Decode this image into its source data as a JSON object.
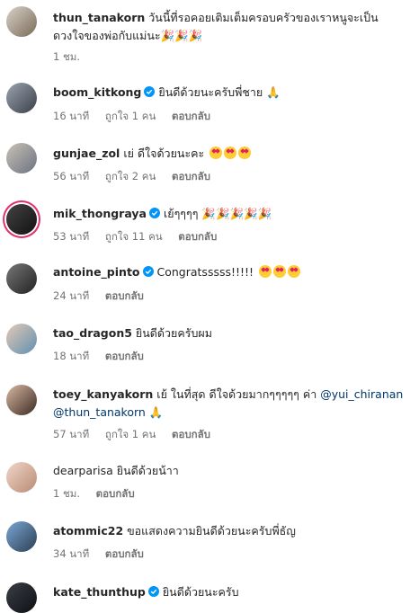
{
  "comments": [
    {
      "username": "thun_tanakorn",
      "text": "วันนี้ที่รอคอยเติมเต็มครอบครัวของเราหนูจะเป็นดวงใจของพ่อกับแม่นะ🎉🎉🎉",
      "time": "1 ชม.",
      "verified": false
    },
    {
      "username": "boom_kitkong",
      "text": "ยินดีด้วยนะครับพี่ชาย 🙏",
      "time": "16 นาที",
      "likes": "ถูกใจ 1 คน",
      "reply": "ตอบกลับ",
      "verified": true
    },
    {
      "username": "gunjae_zol",
      "text": "เย่ ดีใจด้วยนะคะ",
      "time": "56 นาที",
      "likes": "ถูกใจ 2 คน",
      "reply": "ตอบกลับ",
      "verified": false
    },
    {
      "username": "mik_thongraya",
      "text": "เย้ๆๆๆๆ 🎉🎉🎉🎉🎉",
      "time": "53 นาที",
      "likes": "ถูกใจ 11 คน",
      "reply": "ตอบกลับ",
      "verified": true
    },
    {
      "username": "antoine_pinto",
      "text": "Congratsssss!!!!!",
      "time": "24 นาที",
      "reply": "ตอบกลับ",
      "verified": true
    },
    {
      "username": "tao_dragon5",
      "text": "ยินดีด้วยครับผม",
      "time": "18 นาที",
      "reply": "ตอบกลับ",
      "verified": false
    },
    {
      "username": "toey_kanyakorn",
      "text": "เย้ ในที่สุด ดีใจด้วยมากๆๆๆๆๆ ค่า",
      "mention1": "@yui_chiranan",
      "mention2": "@thun_tanakorn",
      "text_end": "🙏",
      "time": "57 นาที",
      "likes": "ถูกใจ 1 คน",
      "reply": "ตอบกลับ",
      "verified": false
    },
    {
      "username": "dearparisa",
      "text": "ยินดีด้วยน้าา",
      "time": "1 ชม.",
      "reply": "ตอบกลับ",
      "verified": false
    },
    {
      "username": "atommic22",
      "text": "ขอแสดงความยินดีด้วยนะครับพี่ธัญ",
      "time": "34 นาที",
      "reply": "ตอบกลับ",
      "verified": false
    },
    {
      "username": "kate_thunthup",
      "text": "ยินดีด้วยนะครับ",
      "verified": true
    }
  ],
  "colors": {
    "verified": "#0095f6",
    "mention": "#00376b",
    "meta": "#737373",
    "story_ring": "#e1306c"
  }
}
